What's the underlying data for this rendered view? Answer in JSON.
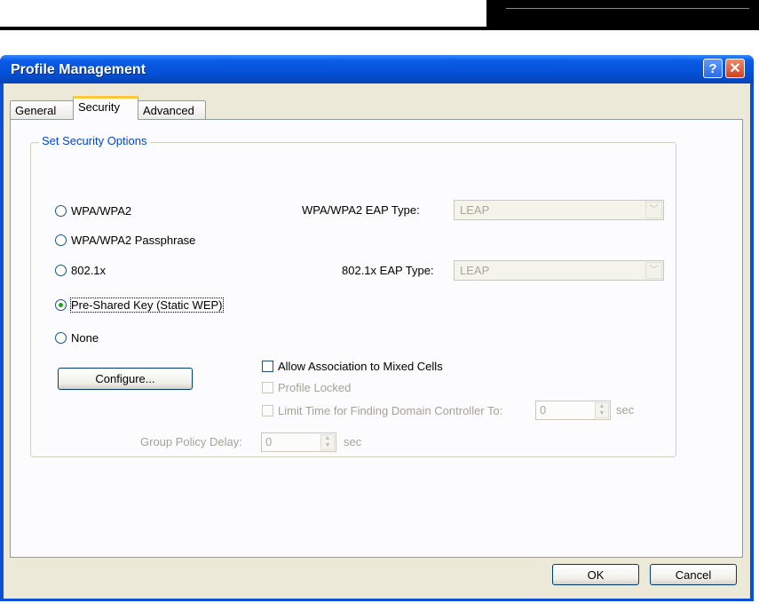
{
  "window": {
    "title": "Profile Management",
    "help_glyph": "?",
    "close_glyph": "✕"
  },
  "tabs": [
    {
      "label": "General"
    },
    {
      "label": "Security"
    },
    {
      "label": "Advanced"
    }
  ],
  "group": {
    "legend": "Set Security Options"
  },
  "options": {
    "wpa": "WPA/WPA2",
    "wpa_passphrase": "WPA/WPA2 Passphrase",
    "dot1x": "802.1x",
    "psk": "Pre-Shared Key (Static WEP)",
    "none": "None",
    "selected": "Pre-Shared Key (Static WEP)"
  },
  "eap": {
    "wpa_label": "WPA/WPA2 EAP Type:",
    "wpa_value": "LEAP",
    "dot1x_label": "802.1x EAP Type:",
    "dot1x_value": "LEAP"
  },
  "buttons": {
    "configure": "Configure...",
    "ok": "OK",
    "cancel": "Cancel"
  },
  "checks": {
    "mixed_cells": "Allow Association to Mixed Cells",
    "profile_locked": "Profile Locked",
    "limit_time": "Limit Time for Finding Domain Controller To:",
    "limit_time_value": "0",
    "limit_time_unit": "sec"
  },
  "group_policy": {
    "label": "Group Policy Delay:",
    "value": "0",
    "unit": "sec"
  },
  "icons": {
    "spin_up": "▲",
    "spin_down": "▼",
    "dropdown": "﹀"
  }
}
